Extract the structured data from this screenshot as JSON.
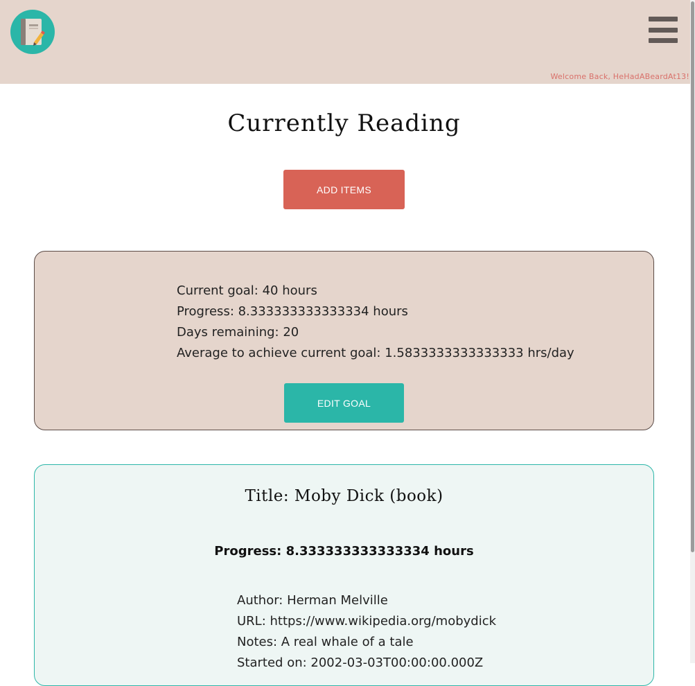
{
  "header": {
    "logo_icon": "notebook-pencil-icon",
    "menu_icon": "hamburger-menu-icon",
    "welcome_text": "Welcome Back, HeHadABeardAt13!",
    "background": "#e5d5cc"
  },
  "main": {
    "title": "Currently Reading",
    "add_items_label": "ADD ITEMS"
  },
  "goal": {
    "current_goal": "Current goal: 40 hours",
    "progress": "Progress: 8.333333333333334 hours",
    "days_remaining": "Days remaining: 20",
    "average": "Average to achieve current goal: 1.5833333333333333 hrs/day",
    "edit_goal_label": "EDIT GOAL"
  },
  "items": [
    {
      "title": "Title: Moby Dick (book)",
      "progress": "Progress: 8.333333333333334 hours",
      "author": "Author: Herman Melville",
      "url": "URL: https://www.wikipedia.org/mobydick",
      "notes": "Notes: A real whale of a tale",
      "started_on": "Started on: 2002-03-03T00:00:00.000Z"
    }
  ],
  "colors": {
    "accent_red": "#d86356",
    "accent_teal": "#2bb6a8",
    "card_beige": "#e5d5cc",
    "welcome_text": "#d9706a"
  }
}
